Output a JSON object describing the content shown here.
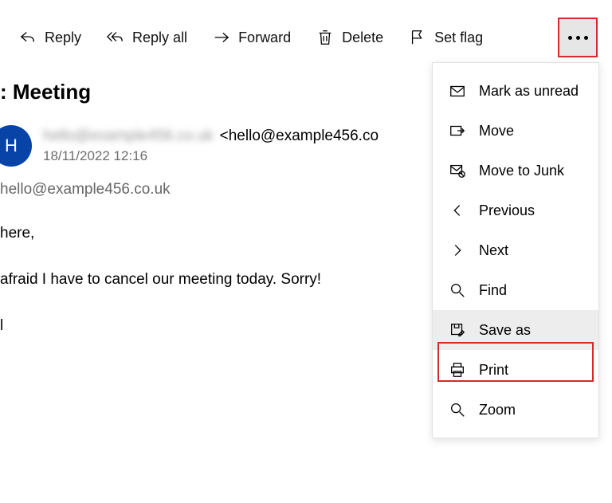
{
  "toolbar": {
    "reply": "Reply",
    "reply_all": "Reply all",
    "forward": "Forward",
    "delete": "Delete",
    "set_flag": "Set flag"
  },
  "subject": ": Meeting",
  "sender": {
    "initial": "H",
    "name_blurred": "hello@example456.co.uk",
    "email": "<hello@example456.co",
    "timestamp": "18/11/2022 12:16"
  },
  "to": "hello@example456.co.uk",
  "body": {
    "line1": "here,",
    "line2": "afraid I have to cancel our meeting today. Sorry!",
    "line3": "l"
  },
  "dropdown": {
    "mark_unread": "Mark as unread",
    "move": "Move",
    "move_to_junk": "Move to Junk",
    "previous": "Previous",
    "next": "Next",
    "find": "Find",
    "save_as": "Save as",
    "print": "Print",
    "zoom": "Zoom"
  }
}
